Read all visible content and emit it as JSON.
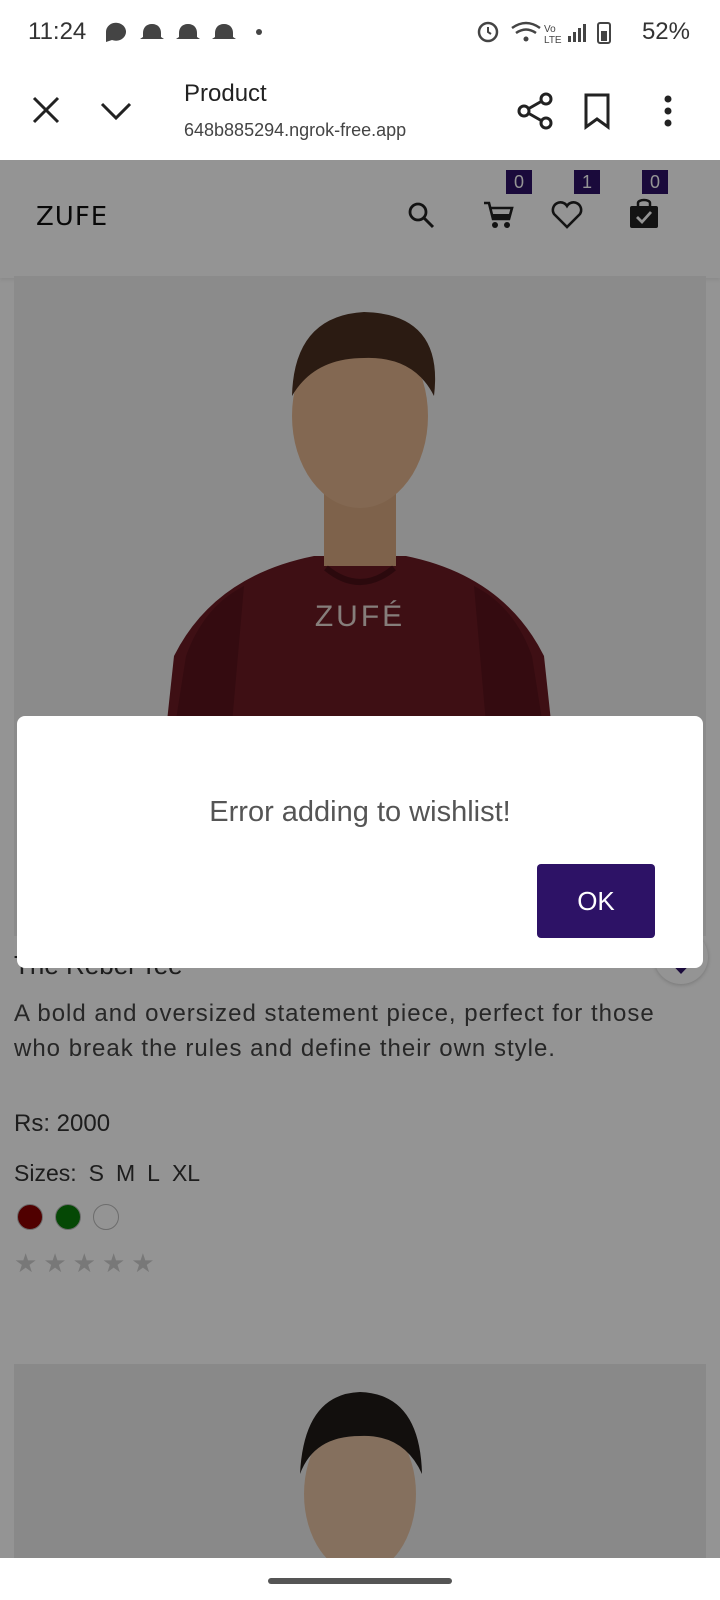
{
  "status": {
    "time": "11:24",
    "battery": "52%"
  },
  "tab": {
    "title": "Product",
    "url": "648b885294.ngrok-free.app"
  },
  "site": {
    "logo": "ZUFE",
    "cart_count": "0",
    "wishlist_count": "1",
    "orders_count": "0"
  },
  "product": {
    "image_text": "ZUFÉ",
    "title": "The Rebel Tee",
    "description": "A bold and oversized statement piece, perfect for those who break the rules and define their own style.",
    "price": "Rs: 2000",
    "sizes_label": "Sizes:",
    "sizes": [
      "S",
      "M",
      "L",
      "XL"
    ],
    "colors": [
      "#8b0000",
      "#0a7d0a",
      "#ffffff"
    ],
    "rating": 0
  },
  "dialog": {
    "message": "Error adding to wishlist!",
    "ok_label": "OK"
  }
}
